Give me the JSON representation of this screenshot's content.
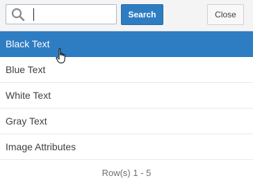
{
  "search": {
    "icon": "search-icon",
    "value": "",
    "placeholder": "",
    "button_label": "Search"
  },
  "close_label": "Close",
  "items": [
    {
      "label": "Black Text",
      "selected": true
    },
    {
      "label": "Blue Text",
      "selected": false
    },
    {
      "label": "White Text",
      "selected": false
    },
    {
      "label": "Gray Text",
      "selected": false
    },
    {
      "label": "Image Attributes",
      "selected": false
    }
  ],
  "footer": {
    "rows_text": "Row(s) 1 - 5"
  },
  "colors": {
    "accent": "#2e7dc3",
    "text": "#404040",
    "muted": "#6f6f6f"
  },
  "cursor_icon": "hand-pointer-icon"
}
